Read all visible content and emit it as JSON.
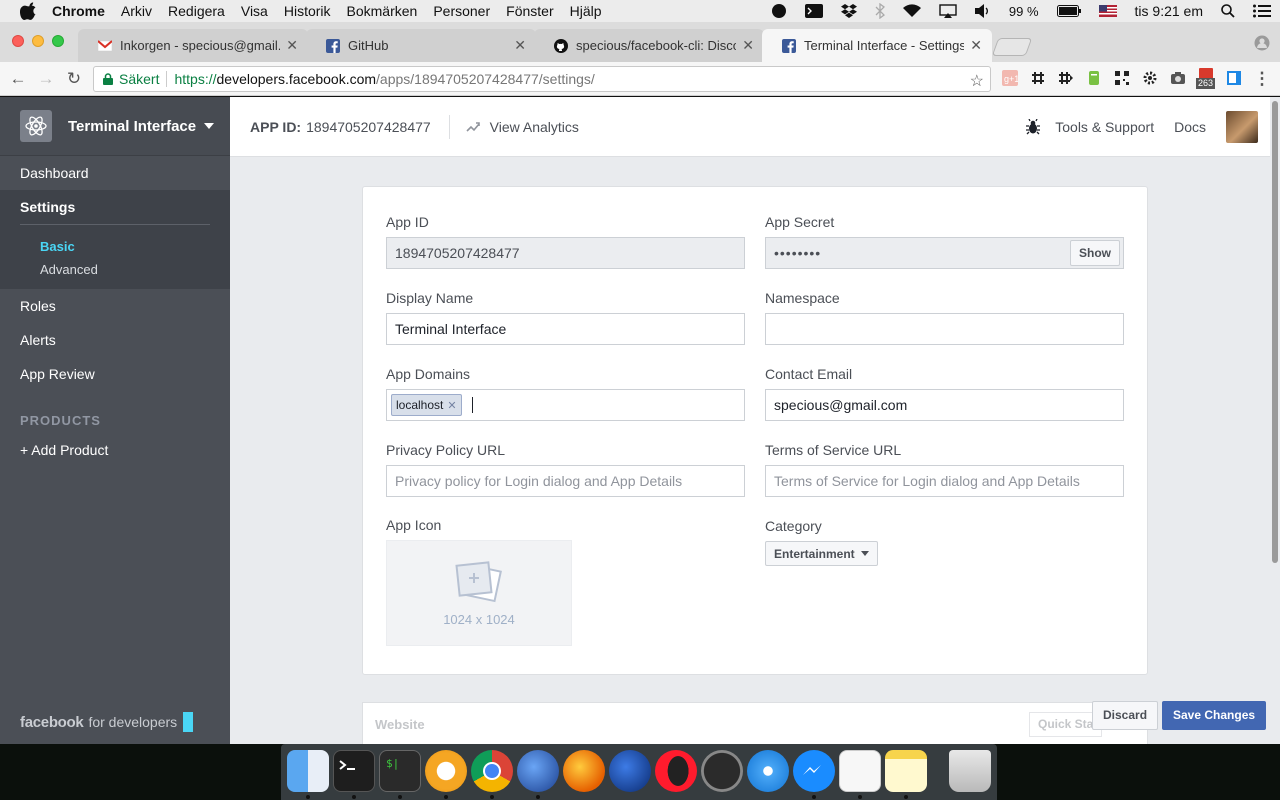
{
  "menubar": {
    "app": "Chrome",
    "items": [
      "Arkiv",
      "Redigera",
      "Visa",
      "Historik",
      "Bokmärken",
      "Personer",
      "Fönster",
      "Hjälp"
    ],
    "battery": "99 %",
    "clock": "tis 9:21 em"
  },
  "tabs": [
    {
      "label": "Inkorgen - specious@gmail.co",
      "icon": "gmail-icon",
      "active": false
    },
    {
      "label": "GitHub",
      "icon": "facebook-icon",
      "active": false
    },
    {
      "label": "specious/facebook-cli: Discov",
      "icon": "github-icon",
      "active": false
    },
    {
      "label": "Terminal Interface - Settings -",
      "icon": "facebook-icon",
      "active": true
    }
  ],
  "omnibox": {
    "secure_label": "Säkert",
    "protocol": "https://",
    "host": "developers.facebook.com",
    "path": "/apps/1894705207428477/settings/"
  },
  "extensions": {
    "badge": "263"
  },
  "sidebar": {
    "app_name": "Terminal Interface",
    "dashboard": "Dashboard",
    "settings": "Settings",
    "basic": "Basic",
    "advanced": "Advanced",
    "roles": "Roles",
    "alerts": "Alerts",
    "app_review": "App Review",
    "products_heading": "PRODUCTS",
    "add_product": "+ Add Product",
    "footer_brand": "facebook",
    "footer_text": "for developers"
  },
  "topbar": {
    "app_id_label": "APP ID:",
    "app_id": "1894705207428477",
    "analytics": "View Analytics",
    "tools": "Tools & Support",
    "docs": "Docs"
  },
  "form": {
    "app_id_label": "App ID",
    "app_id_value": "1894705207428477",
    "app_secret_label": "App Secret",
    "app_secret_value": "••••••••",
    "show_button": "Show",
    "display_name_label": "Display Name",
    "display_name_value": "Terminal Interface",
    "namespace_label": "Namespace",
    "namespace_value": "",
    "app_domains_label": "App Domains",
    "app_domain_token": "localhost",
    "contact_email_label": "Contact Email",
    "contact_email_value": "specious@gmail.com",
    "privacy_label": "Privacy Policy URL",
    "privacy_placeholder": "Privacy policy for Login dialog and App Details",
    "tos_label": "Terms of Service URL",
    "tos_placeholder": "Terms of Service for Login dialog and App Details",
    "app_icon_label": "App Icon",
    "app_icon_size": "1024 x 1024",
    "category_label": "Category",
    "category_value": "Entertainment"
  },
  "bottom": {
    "website_label": "Website",
    "quick_start": "Quick Sta",
    "discard": "Discard",
    "save": "Save Changes"
  },
  "colors": {
    "sidebar": "#4b4f56",
    "accent": "#4ad6f5",
    "primary_button": "#4267b2"
  }
}
